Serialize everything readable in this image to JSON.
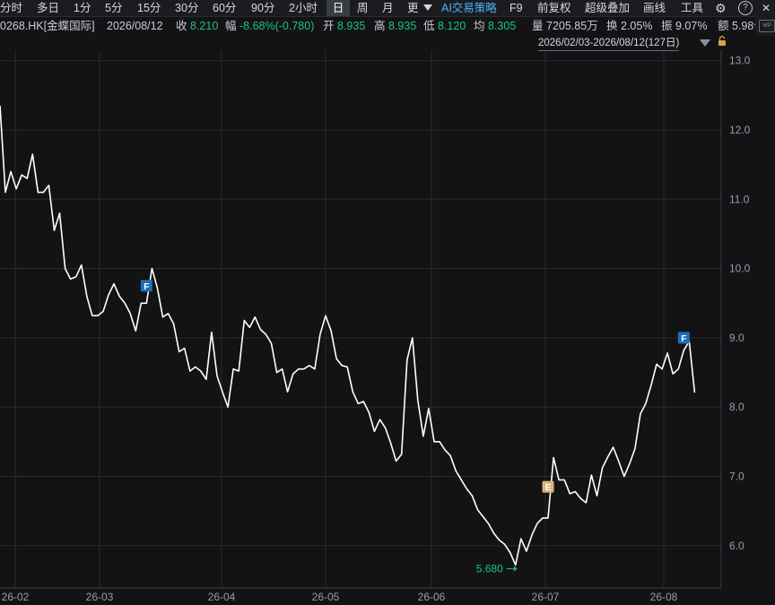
{
  "toolbar": {
    "items": [
      "分时",
      "多日",
      "1分",
      "5分",
      "15分",
      "30分",
      "60分",
      "90分",
      "2小时",
      "日",
      "周",
      "月",
      "更"
    ],
    "active": "日",
    "ai_label": "AI交易策略",
    "f9": "F9",
    "adjust": "前复权",
    "overlay": "超级叠加",
    "draw": "画线",
    "tools": "工具",
    "settings_icon": "gear-icon",
    "help_icon": "help-icon",
    "help_glyph": "?",
    "close_icon": "close-icon",
    "close_glyph": "✕"
  },
  "quote": {
    "code_name": "0268.HK[金蝶国际]",
    "date": "2026/08/12",
    "close_label": "收",
    "close": "8.210",
    "change_label": "幅",
    "change": "-8.68%(-0.780)",
    "open_label": "开",
    "open": "8.935",
    "high_label": "高",
    "high": "8.935",
    "low_label": "低",
    "low": "8.120",
    "avg_label": "均",
    "avg": "8.305",
    "volume_label": "量",
    "volume": "7205.85万",
    "turnover_label": "换",
    "turnover": "2.05%",
    "amplitude_label": "振",
    "amplitude": "9.07%",
    "amount_label": "额",
    "amount": "5.98亿"
  },
  "range_label": "2026/02/03-2026/08/12(127日)",
  "wp_badge": "WP",
  "colors": {
    "background": "#131316",
    "line": "#ffffff",
    "grid": "#2a2b2f",
    "green": "#19c37d",
    "marker_f": "#1f6fb8",
    "marker_e": "#d6b873"
  },
  "chart_data": {
    "type": "line",
    "title": "",
    "xlabel": "",
    "ylabel": "",
    "ylim": [
      5.5,
      13.2
    ],
    "yticks": [
      "13.0",
      "12.0",
      "11.0",
      "10.0",
      "9.0",
      "8.0",
      "7.0",
      "6.0"
    ],
    "x_tick_labels": [
      "26-02",
      "26-03",
      "26-04",
      "26-05",
      "26-06",
      "26-07",
      "26-08"
    ],
    "grid": true,
    "series": [
      {
        "values": [
          12.35,
          11.1,
          11.4,
          11.15,
          11.35,
          11.3,
          11.65,
          11.1,
          11.1,
          11.2,
          10.55,
          10.8,
          10.0,
          9.85,
          9.88,
          10.05,
          9.6,
          9.32,
          9.32,
          9.38,
          9.62,
          9.78,
          9.6,
          9.5,
          9.35,
          9.1,
          9.5,
          9.5,
          10.0,
          9.72,
          9.3,
          9.35,
          9.2,
          8.8,
          8.85,
          8.52,
          8.58,
          8.52,
          8.4,
          9.08,
          8.45,
          8.22,
          8.0,
          8.55,
          8.52,
          9.25,
          9.15,
          9.3,
          9.12,
          9.05,
          8.92,
          8.5,
          8.55,
          8.22,
          8.48,
          8.55,
          8.55,
          8.6,
          8.55,
          9.05,
          9.32,
          9.1,
          8.7,
          8.6,
          8.58,
          8.22,
          8.05,
          8.08,
          7.92,
          7.65,
          7.82,
          7.7,
          7.48,
          7.22,
          7.32,
          8.68,
          9.0,
          8.1,
          7.58,
          7.98,
          7.5,
          7.5,
          7.38,
          7.3,
          7.08,
          6.95,
          6.82,
          6.72,
          6.52,
          6.42,
          6.32,
          6.18,
          6.08,
          6.02,
          5.9,
          5.72,
          6.1,
          5.92,
          6.15,
          6.32,
          6.4,
          6.4,
          7.27,
          6.95,
          6.95,
          6.75,
          6.78,
          6.68,
          6.62,
          7.02,
          6.72,
          7.12,
          7.28,
          7.42,
          7.22,
          7.0,
          7.18,
          7.4,
          7.9,
          8.05,
          8.32,
          8.62,
          8.55,
          8.78,
          8.48,
          8.55,
          8.82,
          8.95,
          8.21
        ]
      }
    ],
    "low_annotation": {
      "value": "5.680",
      "index": 95
    },
    "markers": [
      {
        "label": "F",
        "index": 27,
        "value": 9.75,
        "color": "#1f6fb8"
      },
      {
        "label": "E",
        "index": 101,
        "value": 6.85,
        "color": "#d6b873"
      },
      {
        "label": "F",
        "index": 126,
        "value": 9.0,
        "color": "#1f6fb8"
      }
    ]
  }
}
